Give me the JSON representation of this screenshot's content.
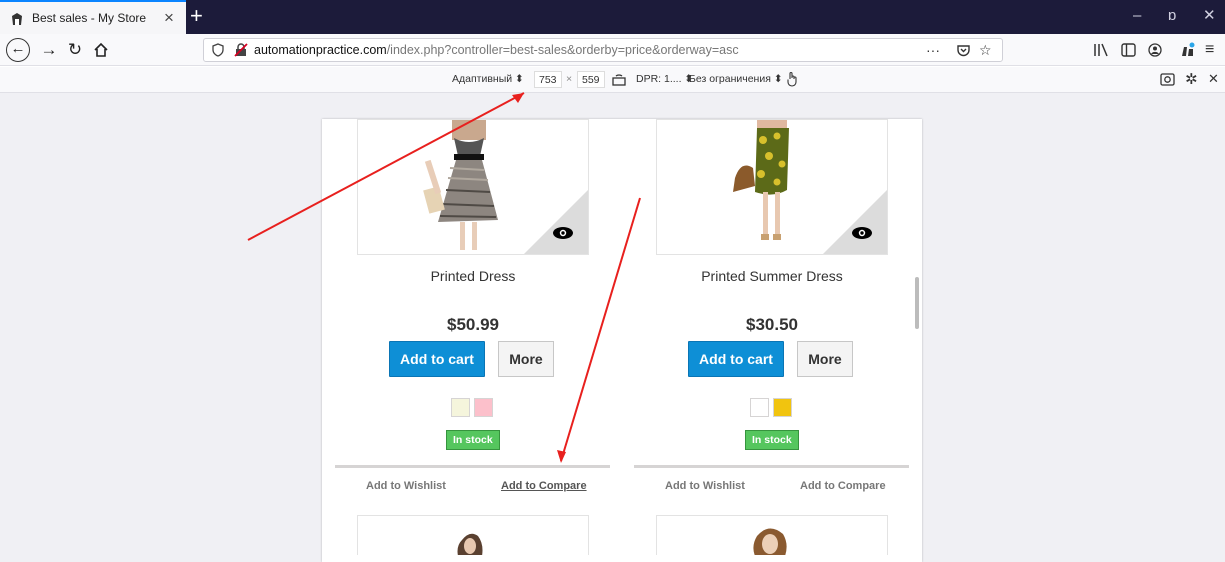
{
  "browser": {
    "tab_title": "Best sales - My Store",
    "tab_close": "×",
    "new_tab": "+",
    "url_host": "automationpractice.com",
    "url_path": "/index.php?controller=best-sales&orderby=price&orderway=asc",
    "page_actions": "···",
    "window_controls": {
      "minimize": "–",
      "restore": "ɒ",
      "close": "✕"
    },
    "nav_icons": [
      "back-icon",
      "forward-icon",
      "reload-icon",
      "home-icon"
    ],
    "toolbar_icons": [
      "library-icon",
      "sidebar-icon",
      "account-icon",
      "extensions-icon",
      "menu-icon"
    ]
  },
  "responsive_toolbar": {
    "device": "Адаптивный ⬍",
    "width": "753",
    "times": "×",
    "height": "559",
    "dpr": "DPR: 1.... ⬍",
    "throttle": "Без ограничения ⬍",
    "close": "✕"
  },
  "products": [
    {
      "name": "Printed Dress",
      "price": "$50.99",
      "add_to_cart": "Add to cart",
      "more": "More",
      "swatch_colors": [
        "#f5f5dc",
        "#fcc0cb"
      ],
      "stock": "In stock",
      "wishlist": "Add to Wishlist",
      "compare": "Add to Compare"
    },
    {
      "name": "Printed Summer Dress",
      "price": "$30.50",
      "add_to_cart": "Add to cart",
      "more": "More",
      "swatch_colors": [
        "#ffffff",
        "#f1c40f"
      ],
      "stock": "In stock",
      "wishlist": "Add to Wishlist",
      "compare": "Add to Compare"
    }
  ],
  "colors": {
    "cart_button": "#0e8fd6",
    "stock_badge": "#55c65e",
    "annotation_arrow": "#e8201e",
    "tab_bar": "#1c1b3a"
  }
}
